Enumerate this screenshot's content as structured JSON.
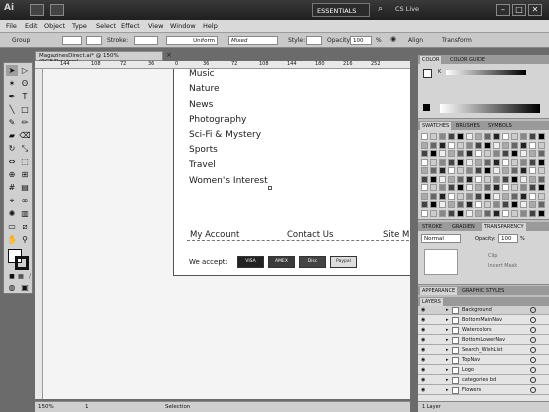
{
  "titlebar": {
    "app_logo": "Ai",
    "workspace": "ESSENTIALS",
    "cs_live": "CS Live",
    "minimize": "–",
    "maximize": "□",
    "close": "✕"
  },
  "menu": [
    "File",
    "Edit",
    "Object",
    "Type",
    "Select",
    "Effect",
    "View",
    "Window",
    "Help"
  ],
  "control": {
    "group": "Group",
    "stroke_label": "Stroke:",
    "stroke_style": "Uniform",
    "brush": "Mixed",
    "style_label": "Style:",
    "opacity_label": "Opacity:",
    "opacity_value": "100",
    "opacity_unit": "%",
    "align_label": "Align",
    "transform_label": "Transform"
  },
  "document": {
    "tab_title": "MagazinesDirect.ai* @ 150% (RGB/Preview)",
    "close": "×",
    "ruler_marks": [
      "144",
      "108",
      "72",
      "36",
      "0",
      "36",
      "72",
      "108",
      "144",
      "180",
      "216",
      "252"
    ]
  },
  "nav_items": [
    "Music",
    "Nature",
    "News",
    "Photography",
    "Sci-Fi & Mystery",
    "Sports",
    "Travel",
    "Women's Interest"
  ],
  "footer": {
    "links": [
      "My Account",
      "Contact Us",
      "Site M"
    ],
    "accept_label": "We accept:",
    "cards": [
      "VISA",
      "AMEX",
      "Disc",
      "Paypal"
    ]
  },
  "status": {
    "zoom": "150%",
    "artboard": "1",
    "tool": "Selection"
  },
  "panels": {
    "color_tabs": [
      "COLOR",
      "COLOR GUIDE"
    ],
    "color_k": "K",
    "swatch_tabs": [
      "SWATCHES",
      "BRUSHES",
      "SYMBOLS"
    ],
    "stroke_tabs": [
      "STROKE",
      "GRADIEN",
      "TRANSPARENCY"
    ],
    "blend_mode": "Normal",
    "opacity_label": "Opacity:",
    "opacity_value": "100",
    "opacity_unit": "%",
    "clip": "Clip",
    "invert_mask": "Invert Mask",
    "appearance_tabs": [
      "APPEARANCE",
      "GRAPHIC STYLES"
    ],
    "layers_tab": "LAYERS",
    "layers": [
      "Background",
      "BottomMainNav",
      "Watercolors",
      "BottomLowerNav",
      "Search_WishList",
      "TopNav",
      "Logo",
      "categories bd",
      "Flowers"
    ],
    "layers_count": "1 Layer"
  },
  "colors": {
    "accent": "#1a1a1a",
    "panel": "#d4d4d4"
  }
}
